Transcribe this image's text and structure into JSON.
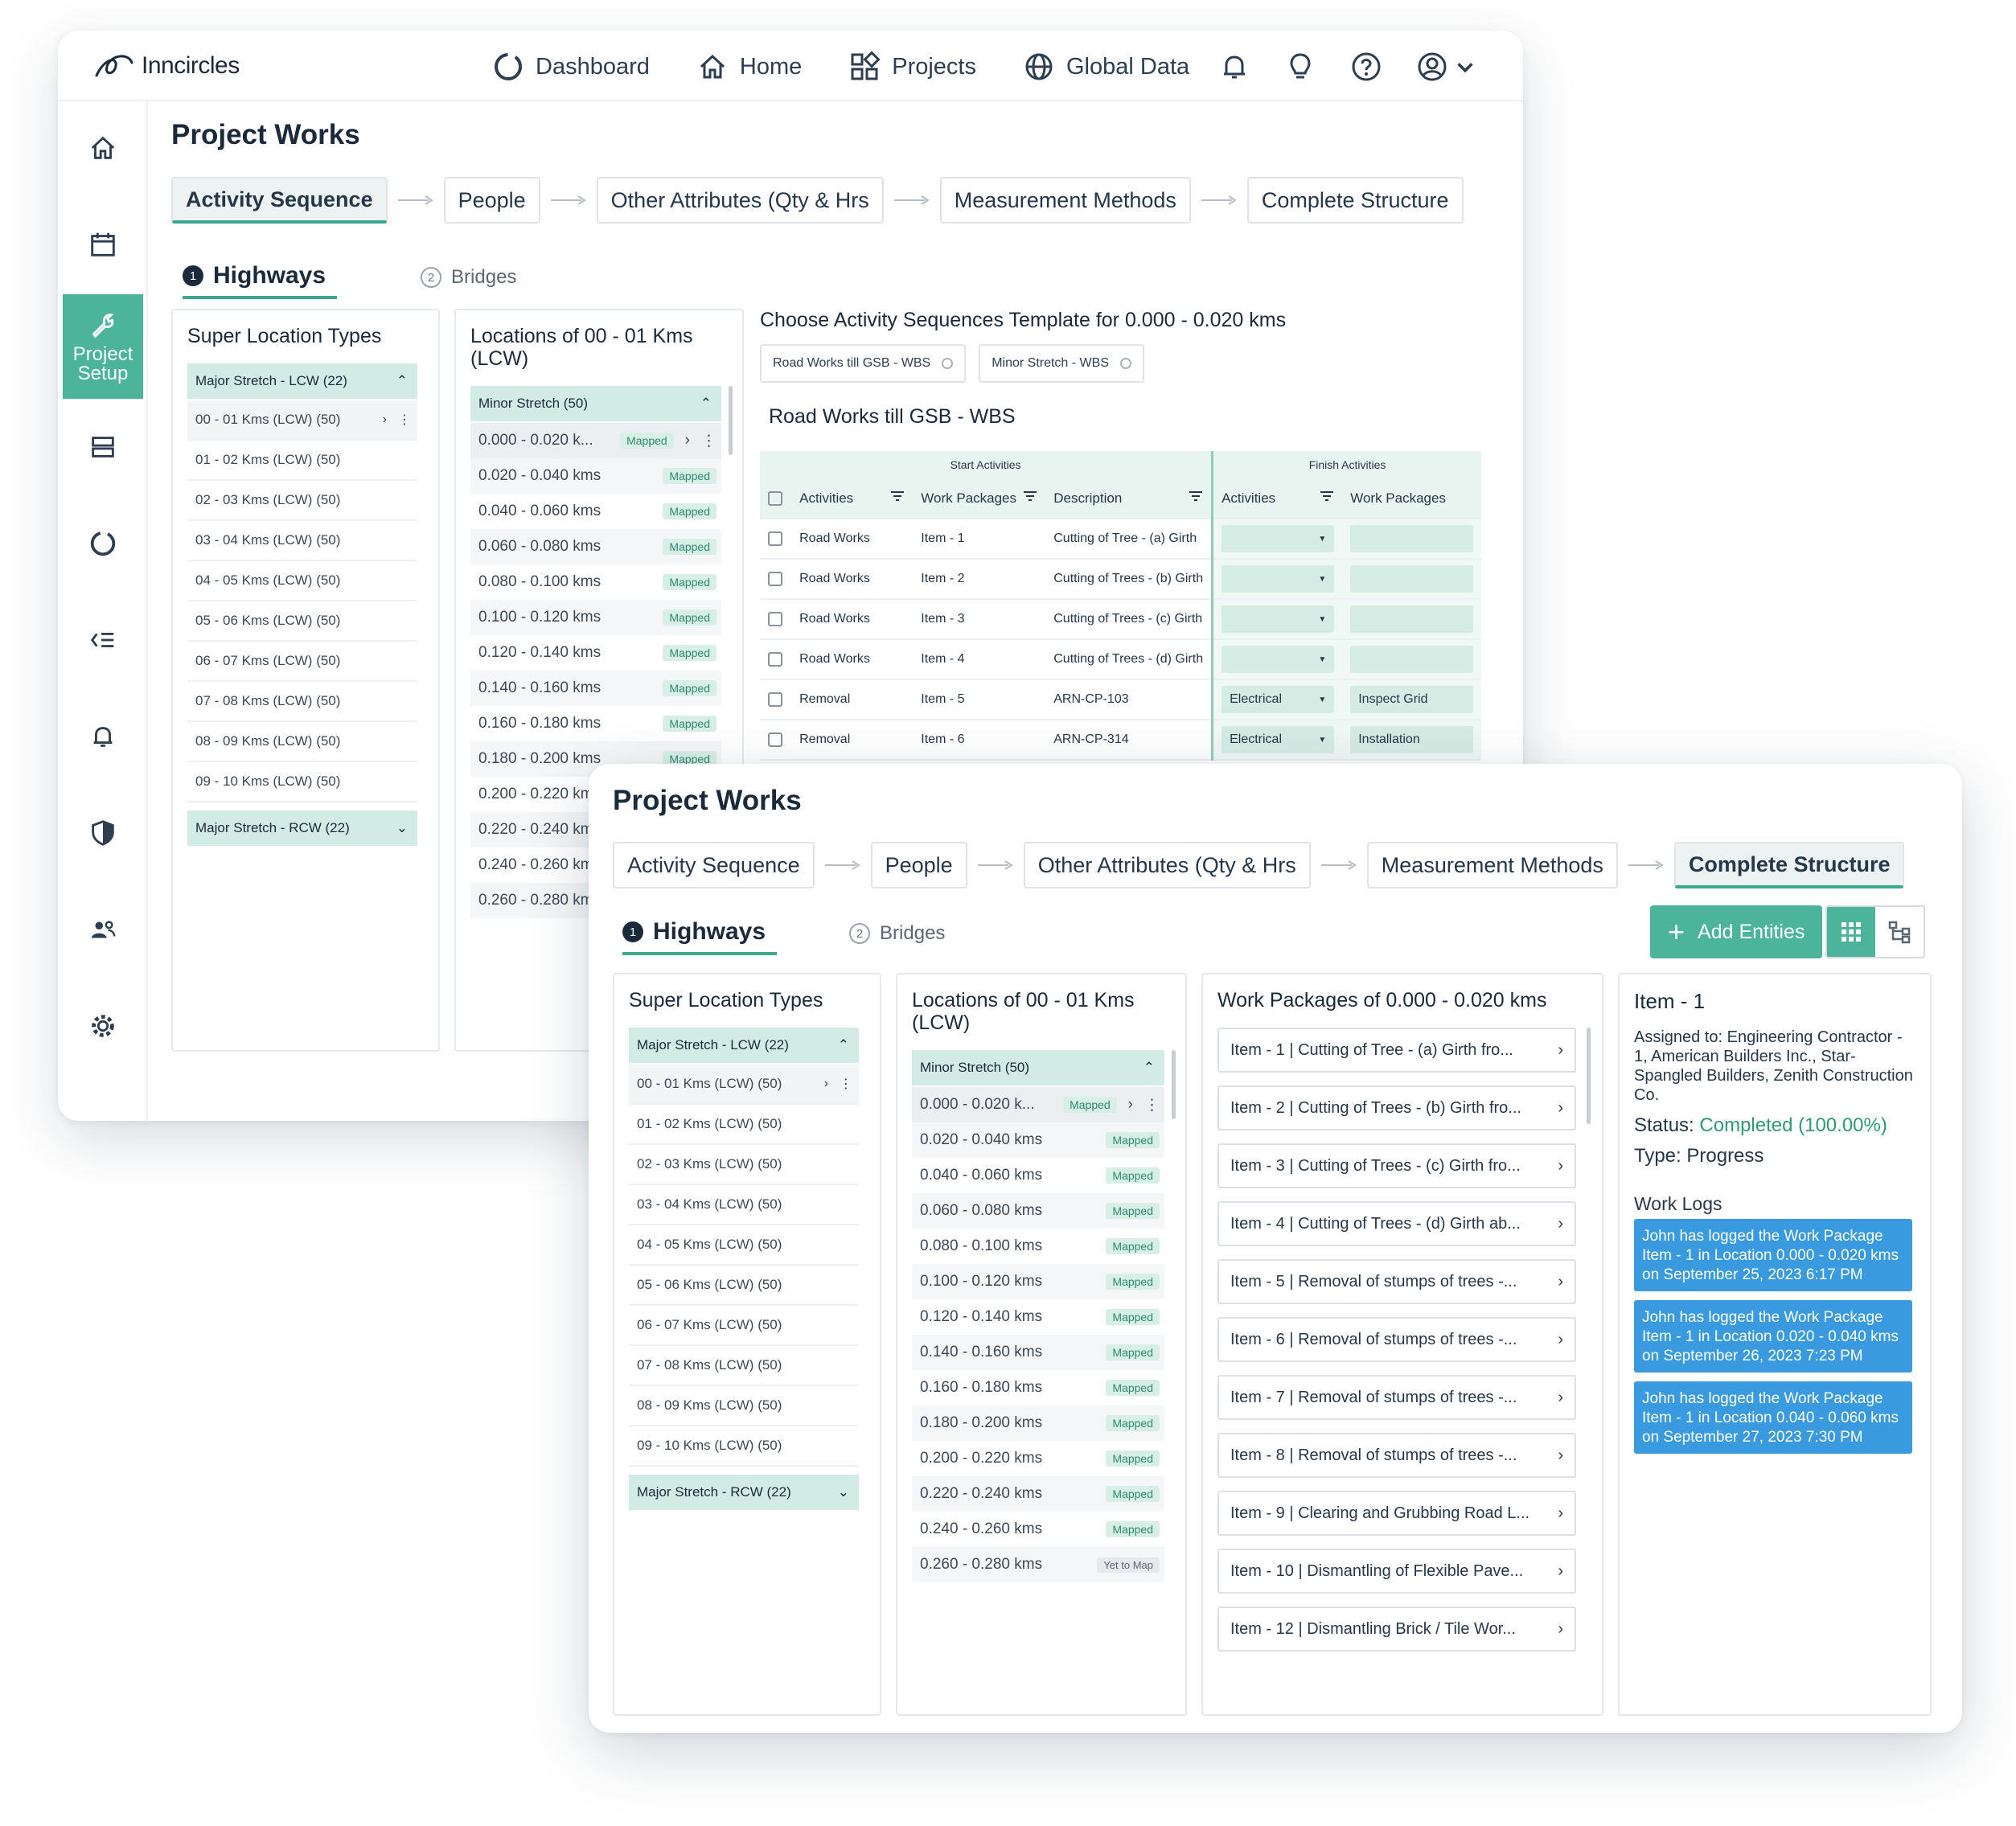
{
  "app": {
    "logo_text": "Inncircles",
    "nav": [
      "Dashboard",
      "Home",
      "Projects",
      "Global Data"
    ],
    "sidebar_active_label": "Project Setup"
  },
  "page_title": "Project Works",
  "steps": [
    "Activity Sequence",
    "People",
    "Other Attributes (Qty & Hrs",
    "Measurement Methods",
    "Complete Structure"
  ],
  "subtabs": [
    {
      "num": "1",
      "label": "Highways"
    },
    {
      "num": "2",
      "label": "Bridges"
    }
  ],
  "super_locations": {
    "title": "Super Location Types",
    "group1": "Major Stretch - LCW (22)",
    "rows": [
      "00 - 01 Kms (LCW) (50)",
      "01 - 02 Kms (LCW) (50)",
      "02 - 03 Kms (LCW) (50)",
      "03 - 04 Kms (LCW) (50)",
      "04 - 05 Kms (LCW) (50)",
      "05 - 06 Kms (LCW) (50)",
      "06 - 07 Kms (LCW) (50)",
      "07 - 08 Kms (LCW) (50)",
      "08 - 09 Kms (LCW) (50)",
      "09 - 10 Kms (LCW) (50)"
    ],
    "group2": "Major Stretch - RCW (22)"
  },
  "locations": {
    "title": "Locations of 00 - 01 Kms (LCW)",
    "group": "Minor Stretch (50)",
    "first": "0.000 - 0.020 k...",
    "rows": [
      "0.020 - 0.040 kms",
      "0.040 - 0.060 kms",
      "0.060 - 0.080 kms",
      "0.080 - 0.100 kms",
      "0.100 - 0.120 kms",
      "0.120 - 0.140 kms",
      "0.140 - 0.160 kms",
      "0.160 - 0.180 kms",
      "0.180 - 0.200 kms",
      "0.200 - 0.220 kms",
      "0.220 - 0.240 kms",
      "0.240 - 0.260 kms",
      "0.260 - 0.280 kms"
    ],
    "mapped": "Mapped",
    "yet_to_map": "Yet to Map"
  },
  "template": {
    "title": "Choose Activity Sequences Template for 0.000 - 0.020 kms",
    "chips": [
      "Road Works till GSB - WBS",
      "Minor Stretch - WBS"
    ],
    "selected_title": "Road Works till GSB - WBS",
    "band_start": "Start Activities",
    "band_finish": "Finish Activities",
    "headers": [
      "Activities",
      "Work Packages",
      "Description",
      "Activities",
      "Work Packages"
    ],
    "rows": [
      {
        "activity": "Road Works",
        "wp": "Item - 1",
        "desc": "Cutting of Tree - (a) Girth",
        "fa": "",
        "fwp": ""
      },
      {
        "activity": "Road Works",
        "wp": "Item - 2",
        "desc": "Cutting of Trees - (b) Girth",
        "fa": "",
        "fwp": ""
      },
      {
        "activity": "Road Works",
        "wp": "Item - 3",
        "desc": "Cutting of Trees - (c) Girth",
        "fa": "",
        "fwp": ""
      },
      {
        "activity": "Road Works",
        "wp": "Item - 4",
        "desc": "Cutting of Trees - (d) Girth",
        "fa": "",
        "fwp": ""
      },
      {
        "activity": "Removal",
        "wp": "Item - 5",
        "desc": "ARN-CP-103",
        "fa": "Electrical",
        "fwp": "Inspect Grid"
      },
      {
        "activity": "Removal",
        "wp": "Item - 6",
        "desc": "ARN-CP-314",
        "fa": "Electrical",
        "fwp": "Installation"
      }
    ]
  },
  "front": {
    "add_entities": "Add Entities",
    "work_packages_title": "Work Packages of 0.000 - 0.020 kms",
    "work_packages": [
      "Item - 1 | Cutting of Tree - (a) Girth fro...",
      "Item - 2 | Cutting of Trees - (b) Girth fro...",
      "Item - 3 | Cutting of Trees - (c) Girth fro...",
      "Item - 4 | Cutting of Trees - (d) Girth ab...",
      "Item - 5 | Removal of stumps of trees -...",
      "Item - 6 | Removal of stumps of trees -...",
      "Item - 7 | Removal of stumps of trees -...",
      "Item - 8 | Removal of stumps of trees -...",
      "Item - 9 | Clearing and Grubbing Road L...",
      "Item - 10 | Dismantling of Flexible Pave...",
      "Item - 12 | Dismantling Brick / Tile Wor..."
    ],
    "detail": {
      "title": "Item - 1",
      "assigned_to": "Assigned to: Engineering Contractor - 1, American Builders Inc., Star-Spangled Builders, Zenith Construction Co.",
      "status_label": "Status:",
      "status_value": "Completed (100.00%)",
      "type": "Type: Progress",
      "logs_title": "Work Logs",
      "logs": [
        "John has logged the Work Package Item - 1 in Location 0.000 - 0.020 kms on September 25, 2023 6:17 PM",
        "John has logged the Work Package Item - 1 in Location 0.020 - 0.040 kms on September 26, 2023 7:23 PM",
        "John has logged the Work Package Item - 1 in Location 0.040 - 0.060 kms on September 27, 2023 7:30 PM"
      ]
    }
  },
  "colors": {
    "accent": "#4bb49b",
    "log_blue": "#3a9ae0",
    "status_green": "#2f9a72"
  }
}
